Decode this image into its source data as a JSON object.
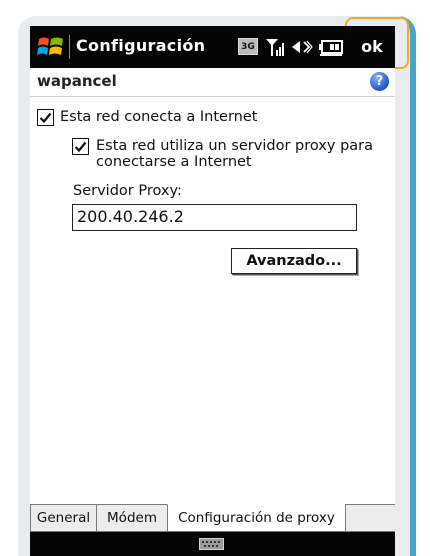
{
  "titlebar": {
    "title": "Configuración",
    "badge_3g": "3G",
    "ok_label": "ok",
    "icons": [
      "windows-logo-icon",
      "signal-3g-icon",
      "signal-bars-icon",
      "volume-icon",
      "battery-icon"
    ]
  },
  "subheader": {
    "title": "wapancel",
    "help_label": "?"
  },
  "form": {
    "check_internet": {
      "label": "Esta red conecta a Internet",
      "checked": true
    },
    "check_proxy": {
      "label_line1": "Esta red utiliza un servidor proxy para",
      "label_line2": "conectarse a Internet",
      "checked": true
    },
    "proxy_label": "Servidor Proxy:",
    "proxy_value": "200.40.246.2",
    "advanced_label": "Avanzado..."
  },
  "tabs": [
    {
      "label": "General",
      "active": false
    },
    {
      "label": "Módem",
      "active": false
    },
    {
      "label": "Configuración de proxy",
      "active": true
    }
  ],
  "bottombar": {
    "icon": "keyboard-icon"
  },
  "colors": {
    "highlight": "#f2a81d",
    "frame_accent": "#4aa3c8",
    "titlebar": "#050505"
  }
}
